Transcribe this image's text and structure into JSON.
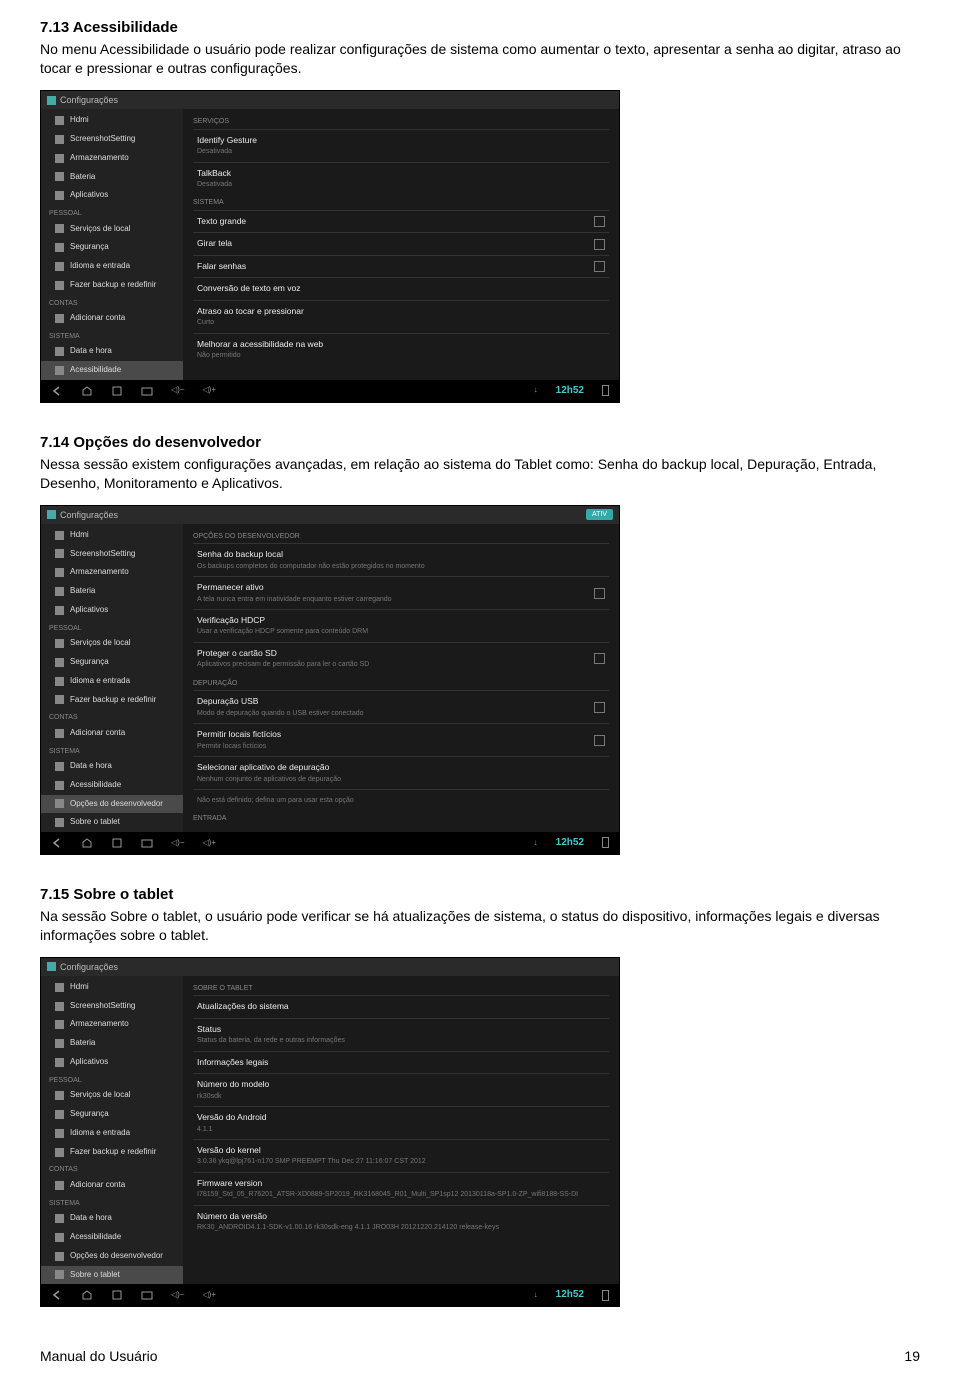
{
  "sections": {
    "s1": {
      "heading": "7.13 Acessibilidade",
      "body": "No menu Acessibilidade o usuário pode realizar configurações de sistema como aumentar o texto, apresentar a senha ao digitar, atraso ao tocar e pressionar e outras configurações."
    },
    "s2": {
      "heading": "7.14 Opções do desenvolvedor",
      "body": "Nessa sessão existem configurações avançadas, em relação ao sistema do Tablet como: Senha do backup local, Depuração, Entrada, Desenho, Monitoramento e Aplicativos."
    },
    "s3": {
      "heading": "7.15 Sobre o tablet",
      "body": "Na sessão Sobre o tablet, o usuário pode verificar se há atualizações de sistema, o status do dispositivo, informações legais e diversas informações sobre o tablet."
    }
  },
  "common": {
    "window_title": "Configurações",
    "clock": "12h52"
  },
  "sidebar_groups": [
    {
      "label": "",
      "items": [
        {
          "t": "Hdmi"
        },
        {
          "t": "ScreenshotSetting"
        },
        {
          "t": "Armazenamento"
        },
        {
          "t": "Bateria"
        },
        {
          "t": "Aplicativos"
        }
      ]
    },
    {
      "label": "PESSOAL",
      "items": [
        {
          "t": "Serviços de local"
        },
        {
          "t": "Segurança"
        },
        {
          "t": "Idioma e entrada"
        },
        {
          "t": "Fazer backup e redefinir"
        }
      ]
    },
    {
      "label": "CONTAS",
      "items": [
        {
          "t": "Adicionar conta"
        }
      ]
    },
    {
      "label": "SISTEMA",
      "items": [
        {
          "t": "Data e hora"
        },
        {
          "t": "Acessibilidade"
        }
      ]
    }
  ],
  "sidebar_s2_extra": [
    {
      "t": "Opções do desenvolvedor"
    },
    {
      "t": "Sobre o tablet"
    }
  ],
  "sidebar_s3_extra": [
    {
      "t": "Opções do desenvolvedor"
    },
    {
      "t": "Sobre o tablet"
    }
  ],
  "content_s1": {
    "groups": [
      {
        "hdr": "SERVIÇOS",
        "rows": [
          {
            "title": "Identify Gesture",
            "sub": "Desativada"
          },
          {
            "title": "TalkBack",
            "sub": "Desativada"
          }
        ]
      },
      {
        "hdr": "SISTEMA",
        "rows": [
          {
            "title": "Texto grande",
            "chk": true
          },
          {
            "title": "Girar tela",
            "chk": true
          },
          {
            "title": "Falar senhas",
            "chk": true
          },
          {
            "title": "Conversão de texto em voz"
          },
          {
            "title": "Atraso ao tocar e pressionar",
            "sub": "Curto"
          },
          {
            "title": "Melhorar a acessibilidade na web",
            "sub": "Não permitido"
          }
        ]
      }
    ]
  },
  "content_s2": {
    "pill": "ATIV",
    "groups_top_title": "Opções do desenvolvedor",
    "rows": [
      {
        "title": "Senha do backup local",
        "sub": "Os backups completos do computador não estão protegidos no momento"
      },
      {
        "title": "Permanecer ativo",
        "sub": "A tela nunca entra em inatividade enquanto estiver carregando",
        "chk": true
      },
      {
        "title": "Verificação HDCP",
        "sub": "Usar a verificação HDCP somente para conteúdo DRM"
      },
      {
        "title": "Proteger o cartão SD",
        "sub": "Aplicativos precisam de permissão para ler o cartão SD",
        "chk": true
      }
    ],
    "sec2_hdr": "DEPURAÇÃO",
    "rows2": [
      {
        "title": "Depuração USB",
        "sub": "Modo de depuração quando o USB estiver conectado",
        "chk": true
      },
      {
        "title": "Permitir locais fictícios",
        "sub": "Permitir locais fictícios",
        "chk": true
      },
      {
        "title": "Selecionar aplicativo de depuração",
        "sub": "Nenhum conjunto de aplicativos de depuração"
      },
      {
        "title": "",
        "sub": "Não está definido; defina um para usar esta opção"
      }
    ],
    "sec3_hdr": "ENTRADA"
  },
  "content_s3": {
    "top_title": "Sobre o tablet",
    "rows": [
      {
        "title": "Atualizações do sistema"
      },
      {
        "title": "Status",
        "sub": "Status da bateria, da rede e outras informações"
      },
      {
        "title": "Informações legais"
      },
      {
        "title": "Número do modelo",
        "sub": "rk30sdk"
      },
      {
        "title": "Versão do Android",
        "sub": "4.1.1"
      },
      {
        "title": "Versão do kernel",
        "sub": "3.0.36\\nykq@lpj761-n170\\nSMP PREEMPT Thu Dec 27 11:16:07 CST 2012"
      },
      {
        "title": "Firmware version",
        "sub": "I78159_Std_05_R76201_ATSR-XD0889-SP2019_RK3168045_R01_Multi_SP1sp12\\n20130118a-SP1.0-ZP_wifi8188-SS-DI"
      },
      {
        "title": "Número da versão",
        "sub": "RK30_ANDROID4.1.1-SDK-v1.00.16\\nrk30sdk-eng 4.1.1 JRO03H 20121220.214120 release-keys"
      }
    ]
  },
  "footer": {
    "left": "Manual do Usuário",
    "page": "19"
  }
}
